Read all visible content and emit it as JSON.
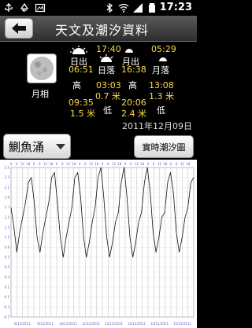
{
  "status_bar": {
    "time": "17:23"
  },
  "header": {
    "title": "天文及潮汐資料"
  },
  "moon": {
    "label": "月相"
  },
  "sun": {
    "sunrise_label": "日出",
    "sunrise_time": "06:51",
    "sunset_label": "日落",
    "sunset_time": "17:40"
  },
  "moon_times": {
    "moonrise_label": "月出",
    "moonrise_time": "16:38",
    "moonset_label": "月落",
    "moonset_time": "05:29"
  },
  "tides": {
    "high_label": "高",
    "low_label": "低",
    "entries": [
      {
        "time": "09:35",
        "height": "1.5 米"
      },
      {
        "time": "03:03",
        "height": "0.7 米"
      },
      {
        "time": "20:06",
        "height": "2.4 米"
      },
      {
        "time": "13:08",
        "height": "1.3 米"
      }
    ]
  },
  "date": "2011年12月09日",
  "controls": {
    "spot": "鰂魚涌",
    "realtime_button": "實時潮汐圖"
  },
  "chart_data": {
    "type": "line",
    "ylim": [
      -0.5,
      2.5
    ],
    "y_ticks": [
      "2.5",
      "2.3",
      "2.1",
      "1.9",
      "1.7",
      "1.5",
      "1.3",
      "1.1",
      "0.9",
      "0.7",
      "0.5",
      "0.3",
      "0.1",
      "-0.1",
      "-0.3",
      "-0.5"
    ],
    "top_tick_labels": [
      "0",
      "6",
      "12",
      "18",
      "0",
      "6",
      "12",
      "18",
      "0",
      "6",
      "12",
      "18",
      "0",
      "6",
      "12",
      "18",
      "0",
      "6",
      "12",
      "18",
      "0",
      "6",
      "12",
      "18",
      "0",
      "6",
      "12",
      "18",
      "0",
      "6",
      "12",
      "18"
    ],
    "x_date_labels": [
      "8/12/2011",
      "9/12/2011",
      "10/12/2011",
      "11/12/2011",
      "12/12/2011",
      "13/12/2011",
      "14/12/2011",
      "15/12/2011"
    ],
    "series": [
      {
        "x": [
          0,
          3,
          6,
          9,
          12,
          15,
          18,
          21,
          24,
          27,
          30,
          33,
          36,
          39,
          42,
          45,
          48,
          51,
          54,
          57,
          60,
          63,
          66,
          69,
          72,
          75,
          78,
          81,
          84,
          87,
          90,
          93,
          96,
          99,
          102,
          105,
          108,
          111,
          114,
          117,
          120,
          123,
          126,
          129,
          132,
          135,
          138,
          141,
          144,
          147,
          150,
          153,
          156,
          159,
          162,
          165,
          168,
          171,
          174,
          177,
          180,
          183,
          186,
          189
        ],
        "values": [
          1.7,
          1.3,
          0.8,
          1.2,
          1.5,
          1.8,
          2.2,
          2.3,
          1.8,
          1.1,
          0.8,
          1.2,
          1.5,
          1.8,
          2.3,
          2.4,
          1.8,
          1.1,
          0.7,
          1.1,
          1.4,
          1.7,
          2.3,
          2.4,
          1.9,
          1.1,
          0.7,
          1.0,
          1.4,
          1.7,
          2.3,
          2.5,
          1.9,
          1.1,
          0.7,
          1.0,
          1.4,
          1.6,
          2.2,
          2.5,
          1.9,
          1.1,
          0.7,
          1.0,
          1.4,
          1.6,
          2.2,
          2.5,
          2.0,
          1.2,
          0.8,
          1.1,
          1.5,
          1.6,
          2.2,
          2.4,
          2.0,
          1.2,
          0.8,
          1.1,
          1.5,
          1.7,
          2.2,
          2.3
        ]
      }
    ]
  }
}
